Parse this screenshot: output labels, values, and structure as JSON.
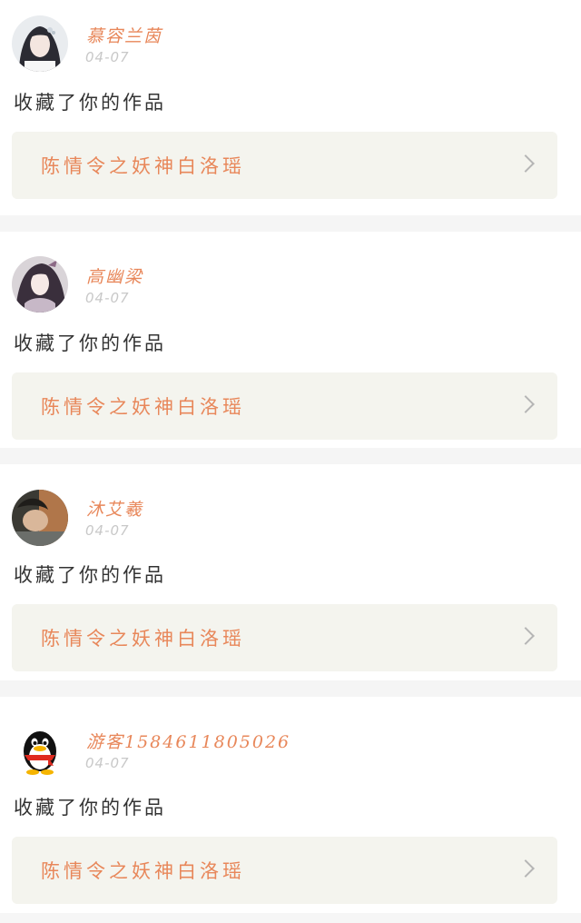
{
  "notifications": [
    {
      "username": "慕容兰茵",
      "time": "04-07",
      "action": "收藏了你的作品",
      "work_title": "陈情令之妖神白洛瑶",
      "avatar": "girl-white-hair-accessory-avatar"
    },
    {
      "username": "高幽梁",
      "time": "04-07",
      "action": "收藏了你的作品",
      "work_title": "陈情令之妖神白洛瑶",
      "avatar": "illustrated-girl-avatar"
    },
    {
      "username": "沐艾羲",
      "time": "04-07",
      "action": "收藏了你的作品",
      "work_title": "陈情令之妖神白洛瑶",
      "avatar": "dark-photo-avatar"
    },
    {
      "username": "游客15846118050​26",
      "time": "04-07",
      "action": "收藏了你的作品",
      "work_title": "陈情令之妖神白洛瑶",
      "avatar": "qq-penguin-avatar"
    }
  ]
}
